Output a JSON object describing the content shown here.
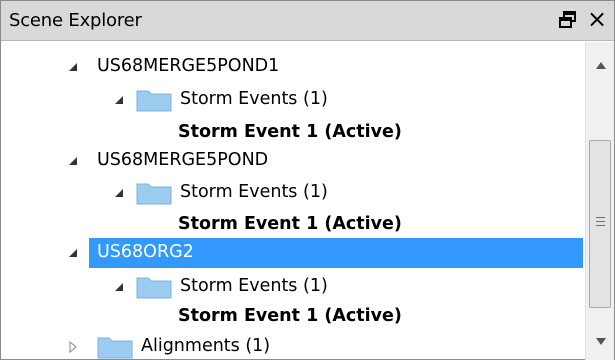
{
  "panel": {
    "title": "Scene Explorer",
    "float_icon": "float-window-icon",
    "close_label": "×"
  },
  "tree": [
    {
      "label": "US68MERGE5POND1",
      "level": 1,
      "expanded": true,
      "bold": false,
      "folder": false,
      "selected": false
    },
    {
      "label": "Storm Events (1)",
      "level": 2,
      "expanded": true,
      "bold": false,
      "folder": true,
      "selected": false
    },
    {
      "label": "Storm Event 1 (Active)",
      "level": 3,
      "expanded": null,
      "bold": true,
      "folder": false,
      "selected": false
    },
    {
      "label": "US68MERGE5POND",
      "level": 1,
      "expanded": true,
      "bold": false,
      "folder": false,
      "selected": false
    },
    {
      "label": "Storm Events (1)",
      "level": 2,
      "expanded": true,
      "bold": false,
      "folder": true,
      "selected": false
    },
    {
      "label": "Storm Event 1 (Active)",
      "level": 3,
      "expanded": null,
      "bold": true,
      "folder": false,
      "selected": false
    },
    {
      "label": "US68ORG2",
      "level": 1,
      "expanded": true,
      "bold": false,
      "folder": false,
      "selected": true
    },
    {
      "label": "Storm Events (1)",
      "level": 2,
      "expanded": true,
      "bold": false,
      "folder": true,
      "selected": false
    },
    {
      "label": "Storm Event 1 (Active)",
      "level": 3,
      "expanded": null,
      "bold": true,
      "folder": false,
      "selected": false
    },
    {
      "label": "Alignments (1)",
      "level": 1,
      "expanded": false,
      "bold": false,
      "folder": true,
      "selected": false
    }
  ],
  "colors": {
    "selection": "#3399ff",
    "folder": "#9ccdf0",
    "titlebar": "#d9d9d9"
  }
}
